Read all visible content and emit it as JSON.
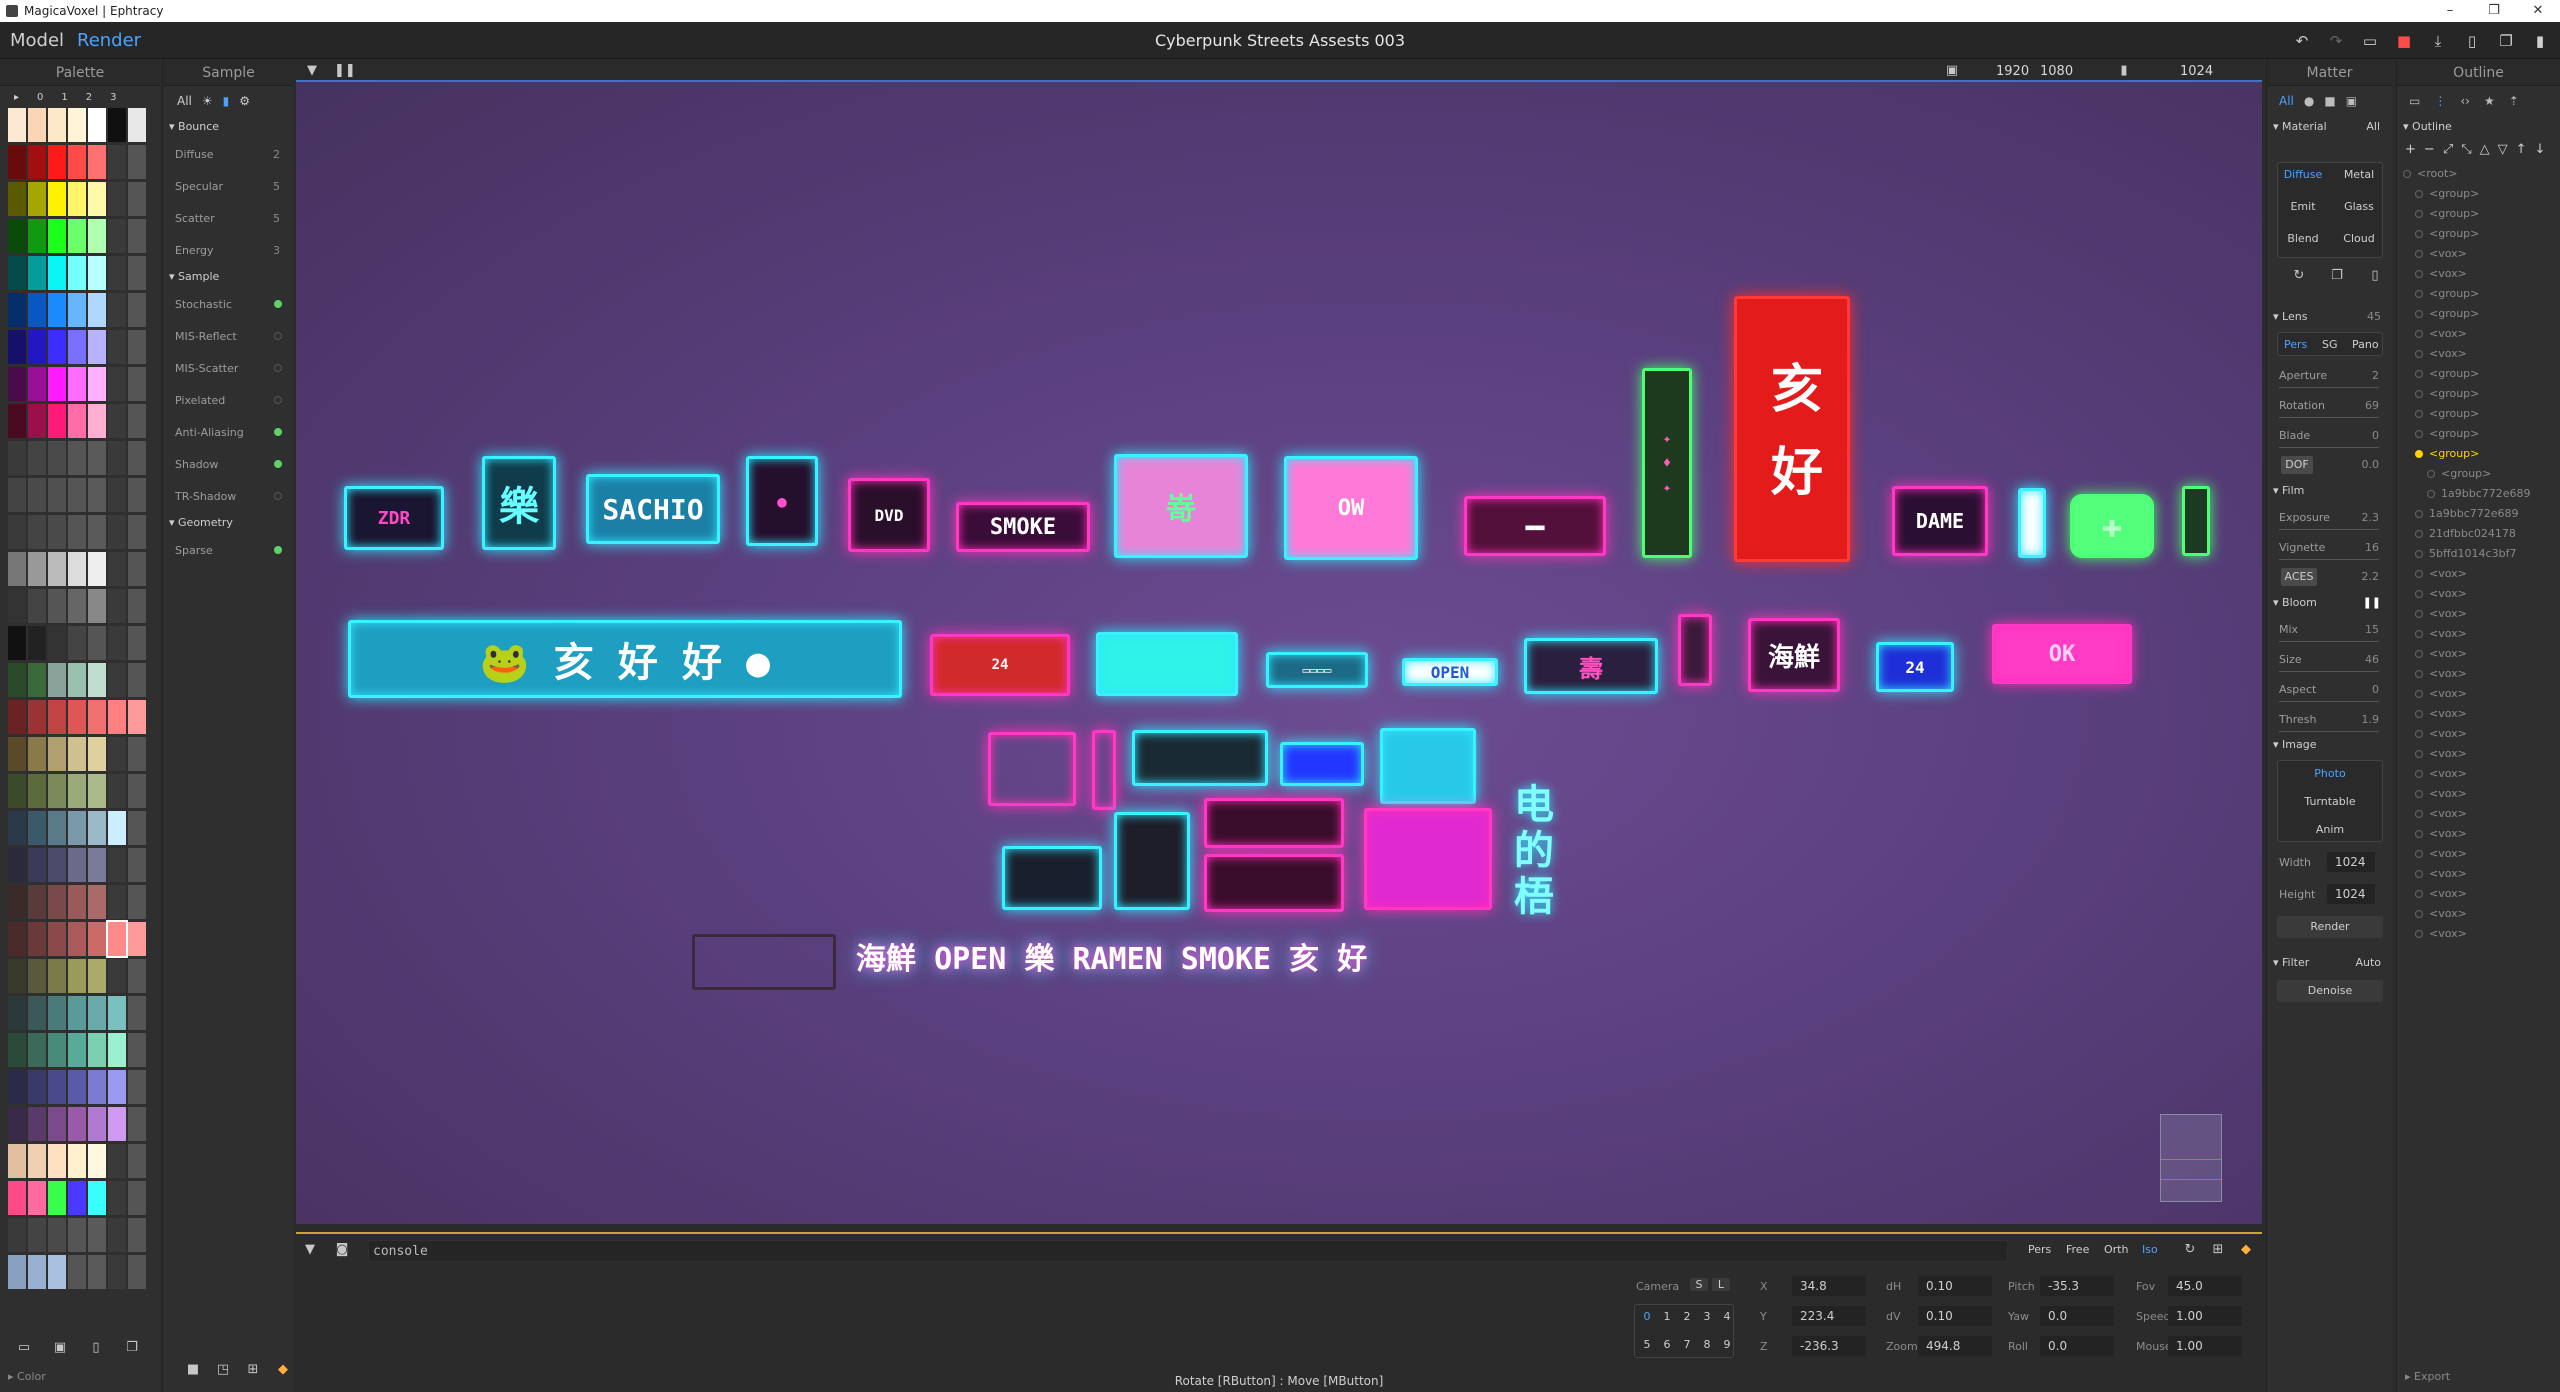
{
  "window": {
    "title": "MagicaVoxel | Ephtracy",
    "controls": [
      "–",
      "❐",
      "✕"
    ]
  },
  "menubar": {
    "model_tab": "Model",
    "render_tab": "Render",
    "doc_title": "Cyberpunk Streets Assests 003"
  },
  "left": {
    "palette_title": "Palette",
    "sample_title": "Sample",
    "palette_tabs": [
      "▸",
      "0",
      "1",
      "2",
      "3"
    ],
    "color_label": "Color",
    "sample_filters": [
      "All"
    ],
    "bounce": {
      "label": "Bounce",
      "rows": [
        {
          "label": "Diffuse",
          "value": "2"
        },
        {
          "label": "Specular",
          "value": "5"
        },
        {
          "label": "Scatter",
          "value": "5"
        },
        {
          "label": "Energy",
          "value": "3"
        }
      ]
    },
    "sample": {
      "label": "Sample",
      "rows": [
        {
          "label": "Stochastic",
          "on": true
        },
        {
          "label": "MIS-Reflect",
          "on": false
        },
        {
          "label": "MIS-Scatter",
          "on": false
        },
        {
          "label": "Pixelated",
          "on": false
        },
        {
          "label": "Anti-Aliasing",
          "on": true
        },
        {
          "label": "Shadow",
          "on": true
        },
        {
          "label": "TR-Shadow",
          "on": false
        }
      ]
    },
    "geometry": {
      "label": "Geometry",
      "rows": [
        {
          "label": "Sparse",
          "on": true
        }
      ]
    }
  },
  "viewport": {
    "res_w": "1920",
    "res_h": "1080",
    "samples": "1024",
    "signs": {
      "sachio": "SACHIO",
      "smoke": "SMOKE",
      "dame": "DAME",
      "dvd": "DVD",
      "open": "OPEN",
      "ramen": "RAMEN SMOKE",
      "ow": "OW",
      "kanji1": "电的梧",
      "kanji2": "海鮮",
      "k24": "24"
    }
  },
  "console": {
    "value": "console",
    "modes": [
      "Pers",
      "Free",
      "Orth",
      "Iso"
    ],
    "selected_mode": "Iso",
    "camera_label": "Camera",
    "camera_sl": [
      "S",
      "L"
    ],
    "slots": [
      "0",
      "1",
      "2",
      "3",
      "4",
      "5",
      "6",
      "7",
      "8",
      "9"
    ],
    "fields": [
      {
        "label": "X",
        "value": "34.8"
      },
      {
        "label": "Y",
        "value": "223.4"
      },
      {
        "label": "Z",
        "value": "-236.3"
      },
      {
        "label": "dH",
        "value": "0.10"
      },
      {
        "label": "dV",
        "value": "0.10"
      },
      {
        "label": "Zoom",
        "value": "494.8"
      },
      {
        "label": "Pitch",
        "value": "-35.3"
      },
      {
        "label": "Yaw",
        "value": "0.0"
      },
      {
        "label": "Roll",
        "value": "0.0"
      },
      {
        "label": "Fov",
        "value": "45.0"
      },
      {
        "label": "Speed",
        "value": "1.00"
      },
      {
        "label": "Mouse",
        "value": "1.00"
      }
    ],
    "status": "Rotate [RButton] : Move [MButton]"
  },
  "matter": {
    "title": "Matter",
    "filter_all": "All",
    "material": {
      "label": "Material",
      "all": "All",
      "types": [
        "Diffuse",
        "Metal",
        "Emit",
        "Glass",
        "Blend",
        "Cloud"
      ],
      "selected": "Diffuse"
    },
    "lens": {
      "label": "Lens",
      "value": "45",
      "modes": [
        "Pers",
        "SG",
        "Pano"
      ],
      "selected": "Pers",
      "rows": [
        {
          "label": "Aperture",
          "value": "2"
        },
        {
          "label": "Rotation",
          "value": "69"
        },
        {
          "label": "Blade",
          "value": "0"
        }
      ],
      "dof": "DOF",
      "dof_value": "0.0"
    },
    "film": {
      "label": "Film",
      "rows": [
        {
          "label": "Exposure",
          "value": "2.3"
        },
        {
          "label": "Vignette",
          "value": "16"
        }
      ],
      "aces": "ACES",
      "aces_value": "2.2"
    },
    "bloom": {
      "label": "Bloom",
      "rows": [
        {
          "label": "Mix",
          "value": "15"
        },
        {
          "label": "Size",
          "value": "46"
        },
        {
          "label": "Aspect",
          "value": "0"
        },
        {
          "label": "Thresh",
          "value": "1.9"
        }
      ]
    },
    "image": {
      "label": "Image",
      "modes": [
        "Photo",
        "Turntable",
        "Anim"
      ],
      "selected": "Photo",
      "width_label": "Width",
      "width": "1024",
      "height_label": "Height",
      "height": "1024",
      "render": "Render"
    },
    "filter": {
      "label": "Filter",
      "mode": "Auto",
      "denoise": "Denoise"
    }
  },
  "outline": {
    "title": "Outline",
    "section": "Outline",
    "export": "Export",
    "items": [
      "<root>",
      "<group>",
      "<group>",
      "<group>",
      "<vox>",
      "<vox>",
      "<group>",
      "<group>",
      "<vox>",
      "<vox>",
      "<group>",
      "<group>",
      "<group>",
      "<group>",
      "<group>",
      "<group>",
      "1a9bbc772e689",
      "1a9bbc772e689",
      "21dfbbc024178",
      "5bffd1014c3bf7",
      "<vox>",
      "<vox>",
      "<vox>",
      "<vox>",
      "<vox>",
      "<vox>",
      "<vox>",
      "<vox>",
      "<vox>",
      "<vox>",
      "<vox>",
      "<vox>",
      "<vox>",
      "<vox>",
      "<vox>",
      "<vox>",
      "<vox>",
      "<vox>",
      "<vox>"
    ]
  }
}
